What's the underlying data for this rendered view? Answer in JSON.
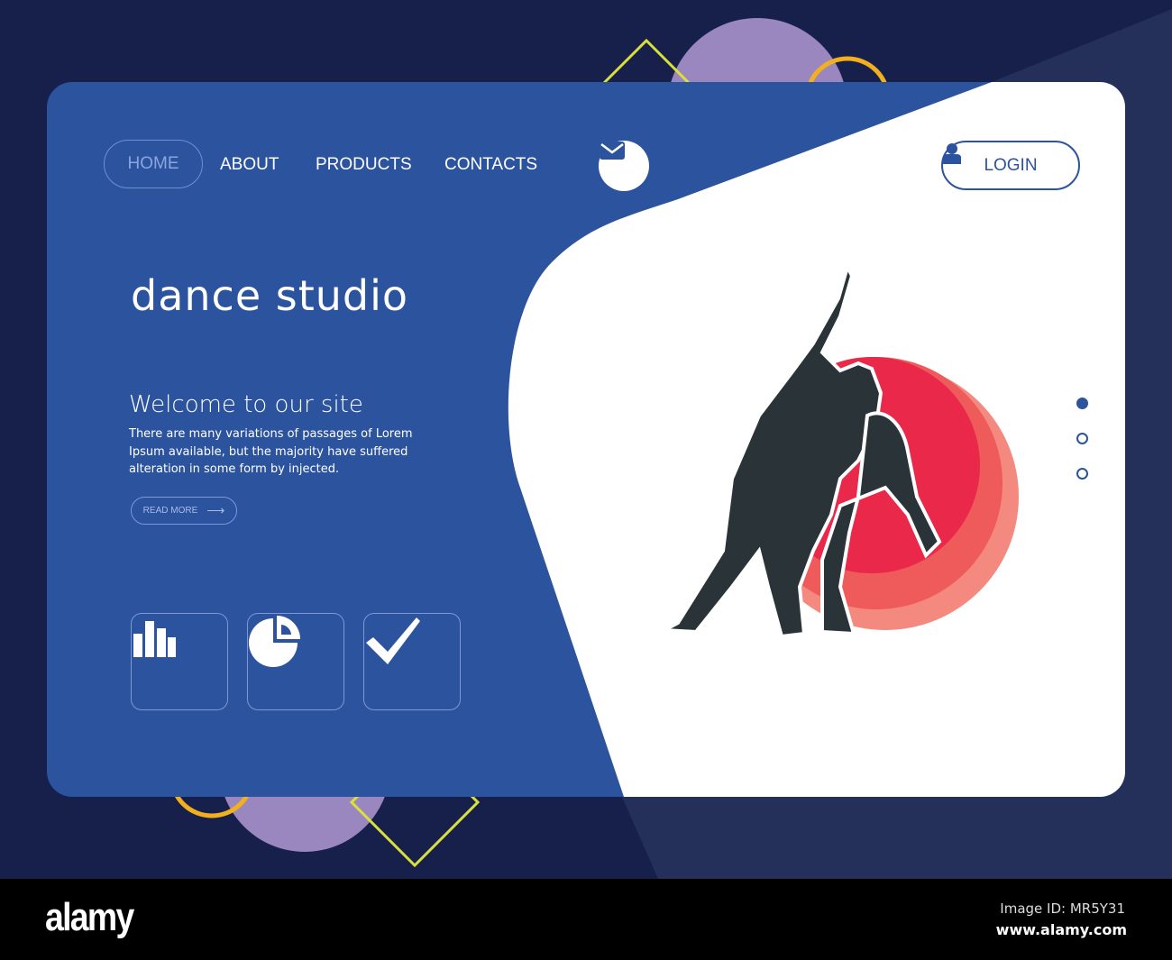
{
  "nav": {
    "items": [
      {
        "label": "HOME",
        "active": true
      },
      {
        "label": "ABOUT"
      },
      {
        "label": "PRODUCTS"
      },
      {
        "label": "CONTACTS"
      }
    ],
    "mail_icon": "envelope-icon",
    "login_label": "LOGIN",
    "login_icon": "user-icon"
  },
  "hero": {
    "title": "dance studio",
    "subtitle": "Welcome to our site",
    "body": "There are many variations of passages of Lorem Ipsum available, but the majority have suffered alteration in some form by injected.",
    "read_more": "READ MORE"
  },
  "features": [
    {
      "icon": "bar-chart-icon"
    },
    {
      "icon": "pie-chart-icon"
    },
    {
      "icon": "checkmark-icon"
    }
  ],
  "slider": {
    "count": 3,
    "active_index": 0
  },
  "colors": {
    "primary": "#2c539e",
    "background": "#16204a",
    "accent_red": "#e9284a"
  },
  "footer": {
    "logo": "alamy",
    "image_id": "Image ID: MR5Y31",
    "url": "www.alamy.com"
  }
}
